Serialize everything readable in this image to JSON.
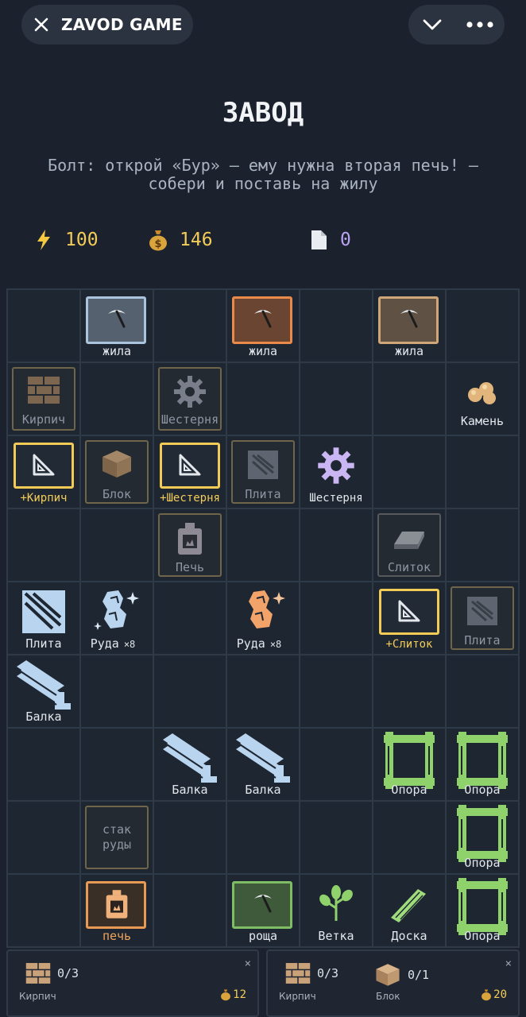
{
  "header": {
    "app_title": "ZAVOD GAME"
  },
  "page": {
    "title": "ЗАВОД",
    "hint": "Болт: открой «Бур» — ему нужна вторая печь! — собери и поставь на жилу"
  },
  "stats": {
    "energy": "100",
    "money": "146",
    "papers": "0"
  },
  "grid": {
    "r1c2": "жила",
    "r1c4": "жила",
    "r1c6": "жила",
    "r2c1": "Кирпич",
    "r2c3": "Шестерня",
    "r2c7": "Камень",
    "r3c1": "+Кирпич",
    "r3c2": "Блок",
    "r3c3": "+Шестерня",
    "r3c4": "Плита",
    "r3c5": "Шестерня",
    "r4c3": "Печь",
    "r4c6": "Слиток",
    "r5c1": "Плита",
    "r5c2": "Руда",
    "r5c2_count": "×8",
    "r5c4": "Руда",
    "r5c4_count": "×8",
    "r5c6": "+Слиток",
    "r5c7": "Плита",
    "r6c1": "Балка",
    "r7c3": "Балка",
    "r7c4": "Балка",
    "r7c6": "Опора",
    "r7c7": "Опора",
    "r8c2_line1": "стак",
    "r8c2_line2": "руды",
    "r8c7": "Опора",
    "r9c2": "печь",
    "r9c4": "роща",
    "r9c5": "Ветка",
    "r9c6": "Доска",
    "r9c7": "Опора"
  },
  "orders": [
    {
      "items": [
        {
          "name": "Кирпич",
          "progress": "0/3"
        }
      ],
      "price": "12",
      "close": "×"
    },
    {
      "items": [
        {
          "name": "Кирпич",
          "progress": "0/3"
        },
        {
          "name": "Блок",
          "progress": "0/1"
        }
      ],
      "price": "20",
      "close": "×"
    }
  ],
  "colors": {
    "gold": "#f3cc58",
    "bolt": "#f5c842",
    "paper_count": "#b9a3f0",
    "support_green": "#8fd16a",
    "steel_blue": "#b8d4ee",
    "copper_ore": "#f2a36a"
  }
}
